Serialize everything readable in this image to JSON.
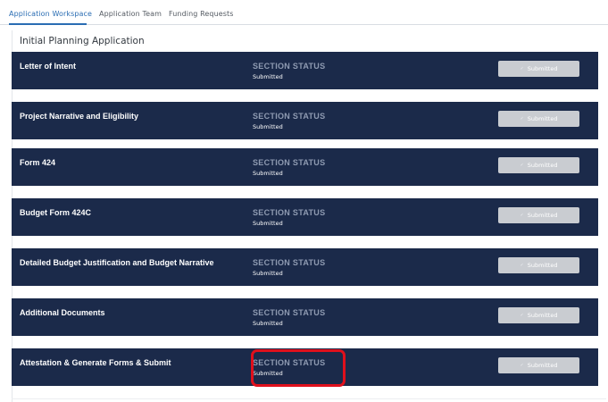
{
  "tabs": [
    {
      "label": "Application Workspace",
      "active": true
    },
    {
      "label": "Application Team",
      "active": false
    },
    {
      "label": "Funding Requests",
      "active": false
    }
  ],
  "panel": {
    "title": "Initial Planning Application"
  },
  "sections": [
    {
      "name": "Letter of Intent",
      "status_label": "SECTION STATUS",
      "status_value": "Submitted",
      "button_label": "Submitted",
      "button_icon": "check-icon"
    },
    {
      "name": "Project Narrative and Eligibility",
      "status_label": "SECTION STATUS",
      "status_value": "Submitted",
      "button_label": "Submitted",
      "button_icon": "check-icon"
    },
    {
      "name": "Form 424",
      "status_label": "SECTION STATUS",
      "status_value": "Submitted",
      "button_label": "Submitted",
      "button_icon": "check-icon"
    },
    {
      "name": "Budget Form 424C",
      "status_label": "SECTION STATUS",
      "status_value": "Submitted",
      "button_label": "Submitted",
      "button_icon": "check-icon"
    },
    {
      "name": "Detailed Budget Justification and Budget Narrative",
      "status_label": "SECTION STATUS",
      "status_value": "Submitted",
      "button_label": "Submitted",
      "button_icon": "check-icon"
    },
    {
      "name": "Additional Documents",
      "status_label": "SECTION STATUS",
      "status_value": "Submitted",
      "button_label": "Submitted",
      "button_icon": "check-icon"
    },
    {
      "name": "Attestation & Generate Forms & Submit",
      "status_label": "SECTION STATUS",
      "status_value": "Submitted",
      "button_label": "Submitted",
      "button_icon": "check-icon"
    }
  ],
  "colors": {
    "accent": "#2a6db3",
    "section_bg": "#1b2a4a",
    "button_disabled": "#c9ccd1",
    "highlight": "#e0101c"
  }
}
